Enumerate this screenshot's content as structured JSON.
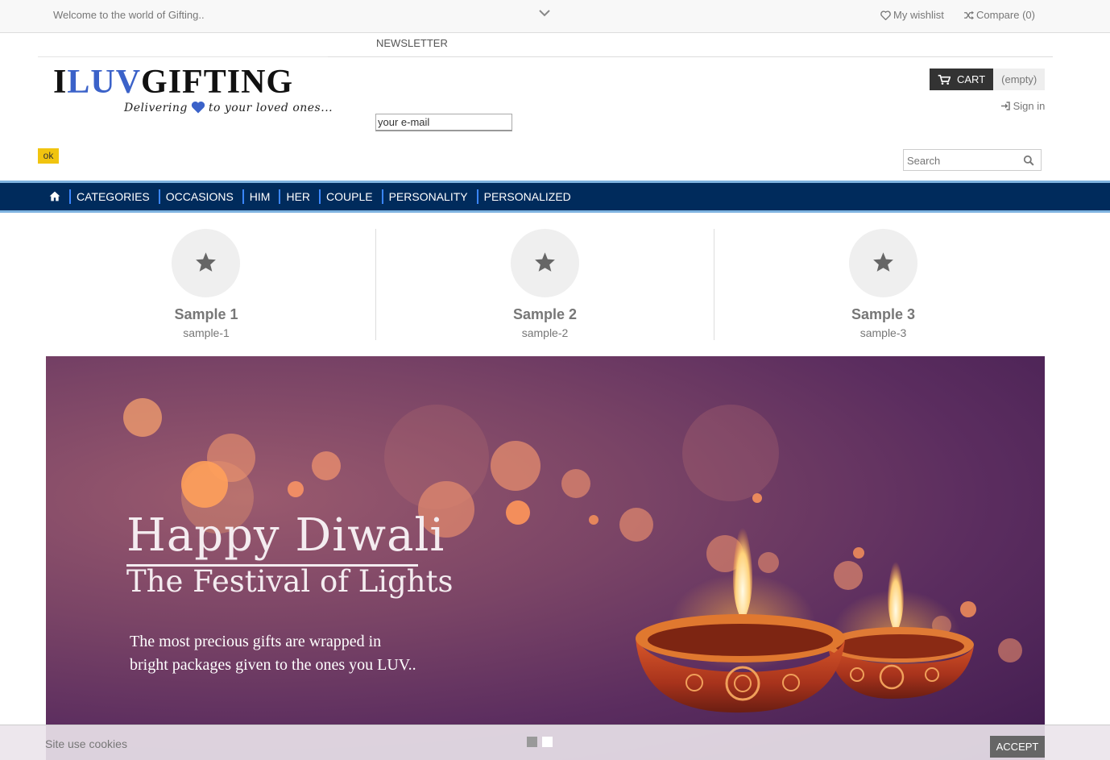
{
  "topbar": {
    "welcome": "Welcome to the world of Gifting..",
    "wishlist": "My wishlist",
    "compare": "Compare (0)"
  },
  "newsletter": {
    "title": "NEWSLETTER",
    "email_value": "your e-mail",
    "ok_label": "ok"
  },
  "logo": {
    "part1": "I",
    "part2": "LUV",
    "part3": "GIFTING",
    "tagline_a": "Delivering",
    "tagline_b": "to your loved ones..."
  },
  "cart": {
    "label": "CART",
    "status": "(empty)"
  },
  "signin": "Sign in",
  "search": {
    "placeholder": "Search"
  },
  "nav": {
    "items": [
      "CATEGORIES",
      "OCCASIONS",
      "HIM",
      "HER",
      "COUPLE",
      "PERSONALITY",
      "PERSONALIZED"
    ]
  },
  "samples": [
    {
      "title": "Sample 1",
      "subtitle": "sample-1"
    },
    {
      "title": "Sample 2",
      "subtitle": "sample-2"
    },
    {
      "title": "Sample 3",
      "subtitle": "sample-3"
    }
  ],
  "banner": {
    "headline": "Happy Diwali",
    "subhead": "The Festival of Lights",
    "line1": "The most precious gifts are wrapped in",
    "line2": "bright packages given to the ones you LUV.."
  },
  "cookie": {
    "text": "Site use cookies",
    "accept": "ACCEPT"
  },
  "colors": {
    "nav_bg": "#002b5c",
    "nav_border": "#7fb3e0",
    "logo_accent": "#3b62c9",
    "ok_button": "#f1c40f"
  }
}
